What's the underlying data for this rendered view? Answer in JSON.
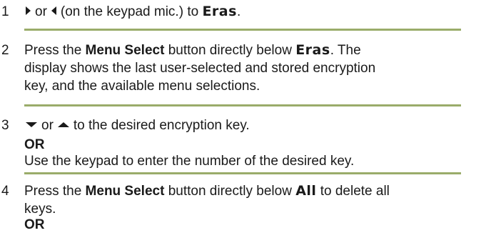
{
  "colors": {
    "text": "#1a1a1a",
    "rule": "#9aac6a",
    "background": "#ffffff"
  },
  "steps": [
    {
      "number": "1",
      "or_word": "or",
      "after_arrows": "(on the keypad mic.) to",
      "display_word": "Eras",
      "period": ".",
      "icons": [
        "right-arrow-icon",
        "left-arrow-icon"
      ]
    },
    {
      "number": "2",
      "press": "Press the",
      "button_name": "Menu Select",
      "mid": "button directly below",
      "display_word": "Eras",
      "rest_line1": ". The",
      "line2": "display shows the last user-selected and stored encryption",
      "line3": "key, and the available menu selections."
    },
    {
      "number": "3",
      "or_word": "or",
      "after_arrows": "to the desired encryption key.",
      "or_heading": "OR",
      "alt_text": "Use the keypad to enter the number of the desired key.",
      "icons": [
        "down-arrow-icon",
        "up-arrow-icon"
      ]
    },
    {
      "number": "4",
      "press": "Press the",
      "button_name": "Menu Select",
      "mid": "button directly below",
      "display_word": "All",
      "rest_line1": "to delete all",
      "line2": "keys.",
      "or_heading": "OR"
    }
  ]
}
